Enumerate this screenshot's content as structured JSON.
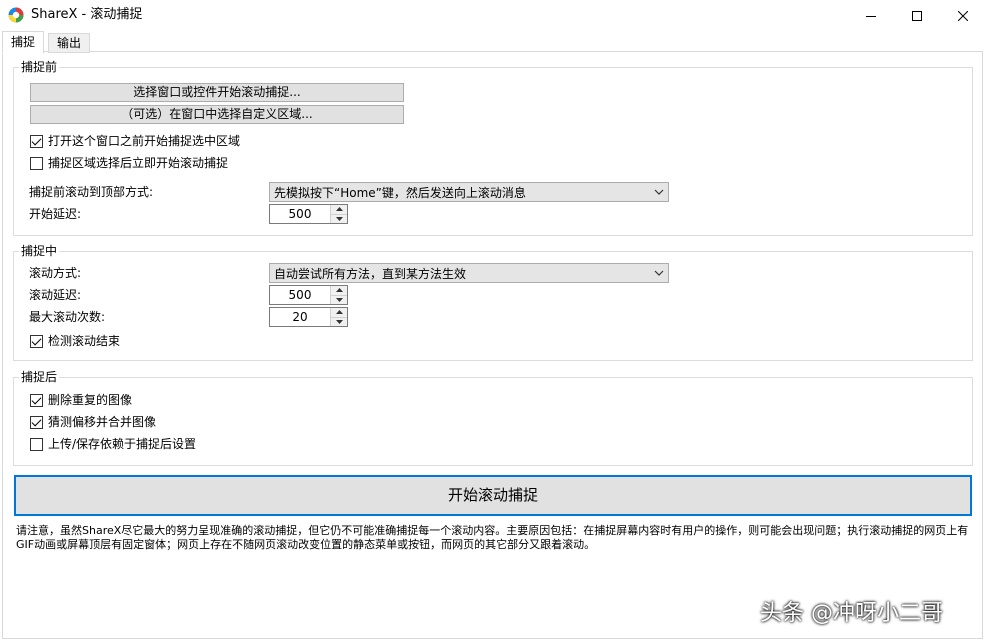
{
  "window": {
    "title": "ShareX - 滚动捕捉",
    "icon": "sharex-logo-icon",
    "controls": [
      "minimize-icon",
      "maximize-icon",
      "close-icon"
    ]
  },
  "tabs": [
    {
      "label": "捕捉",
      "selected": true
    },
    {
      "label": "输出",
      "selected": false
    }
  ],
  "before_capture": {
    "title": "捕捉前",
    "select_window_button": "选择窗口或控件开始滚动捕捉...",
    "select_region_button": "（可选）在窗口中选择自定义区域...",
    "checkboxes": [
      {
        "label": "打开这个窗口之前开始捕捉选中区域",
        "checked": true
      },
      {
        "label": "捕捉区域选择后立即开始滚动捕捉",
        "checked": false
      }
    ],
    "scroll_top_label": "捕捉前滚动到顶部方式:",
    "scroll_top_value": "先模拟按下“Home”键，然后发送向上滚动消息",
    "start_delay_label": "开始延迟:",
    "start_delay_value": "500"
  },
  "during_capture": {
    "title": "捕捉中",
    "scroll_method_label": "滚动方式:",
    "scroll_method_value": "自动尝试所有方法，直到某方法生效",
    "scroll_delay_label": "滚动延迟:",
    "scroll_delay_value": "500",
    "max_scroll_label": "最大滚动次数:",
    "max_scroll_value": "20",
    "detect_end": {
      "label": "检测滚动结束",
      "checked": true
    }
  },
  "after_capture": {
    "title": "捕捉后",
    "checkboxes": [
      {
        "label": "删除重复的图像",
        "checked": true
      },
      {
        "label": "猜测偏移并合并图像",
        "checked": true
      },
      {
        "label": "上传/保存依赖于捕捉后设置",
        "checked": false
      }
    ]
  },
  "start_button": "开始滚动捕捉",
  "notice": "请注意，虽然ShareX尽它最大的努力呈现准确的滚动捕捉，但它仍不可能准确捕捉每一个滚动内容。主要原因包括：在捕捉屏幕内容时有用户的操作，则可能会出现问题；执行滚动捕捉的网页上有GIF动画或屏幕顶层有固定窗体；网页上存在不随网页滚动改变位置的静态菜单或按钮，而网页的其它部分又跟着滚动。",
  "watermark": "头条 @冲呀小二哥"
}
